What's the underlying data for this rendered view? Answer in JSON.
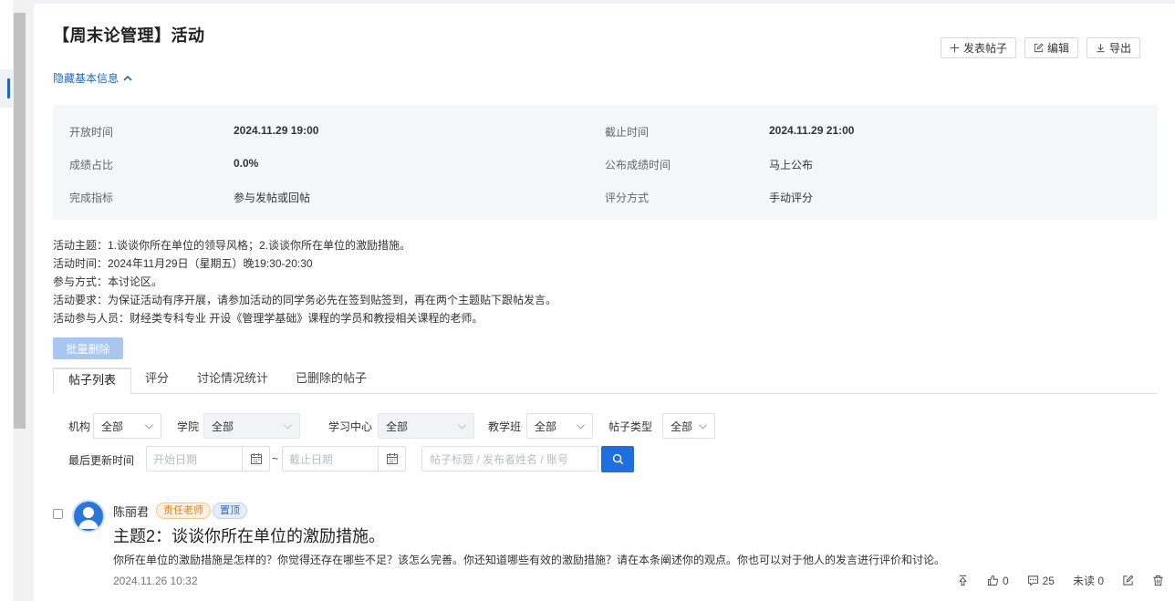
{
  "page": {
    "title": "【周末论管理】活动",
    "toggle_info": "隐藏基本信息"
  },
  "actions": {
    "post": "发表帖子",
    "edit": "编辑",
    "export": "导出"
  },
  "info": [
    {
      "label": "开放时间",
      "value": "2024.11.29 19:00"
    },
    {
      "label": "截止时间",
      "value": "2024.11.29 21:00"
    },
    {
      "label": "成绩占比",
      "value": "0.0%"
    },
    {
      "label": "公布成绩时间",
      "value": "马上公布"
    },
    {
      "label": "完成指标",
      "value": "参与发帖或回帖"
    },
    {
      "label": "评分方式",
      "value": "手动评分"
    }
  ],
  "description": [
    "活动主题：1.谈谈你所在单位的领导风格；2.谈谈你所在单位的激励措施。",
    "活动时间：2024年11月29日（星期五）晚19:30-20:30",
    "参与方式：本讨论区。",
    "活动要求：为保证活动有序开展，请参加活动的同学务必先在签到贴签到，再在两个主题贴下跟帖发言。",
    "活动参与人员：财经类专科专业 开设《管理学基础》课程的学员和教授相关课程的老师。"
  ],
  "batch_delete": "批量删除",
  "tabs": [
    {
      "label": "帖子列表",
      "active": true
    },
    {
      "label": "评分"
    },
    {
      "label": "讨论情况统计"
    },
    {
      "label": "已删除的帖子"
    }
  ],
  "filters": {
    "org_label": "机构",
    "org_value": "全部",
    "college_label": "学院",
    "college_value": "全部",
    "center_label": "学习中心",
    "center_value": "全部",
    "class_label": "教学班",
    "class_value": "全部",
    "type_label": "帖子类型",
    "type_value": "全部",
    "updated_label": "最后更新时间",
    "start_placeholder": "开始日期",
    "end_placeholder": "截止日期",
    "range_sep": "~",
    "search_placeholder": "帖子标题 / 发布者姓名 / 账号"
  },
  "post": {
    "author": "陈丽君",
    "badge_role": "责任老师",
    "badge_pin": "置顶",
    "title": "主题2：谈谈你所在单位的激励措施。",
    "body": "你所在单位的激励措施是怎样的？你觉得还存在哪些不足？该怎么完善。你还知道哪些有效的激励措施？请在本条阐述你的观点。你也可以对于他人的发言进行评价和讨论。",
    "date": "2024.11.26 10:32",
    "likes": "0",
    "comments": "25",
    "unread": "未读 0"
  },
  "colors": {
    "primary": "#1e6fe0",
    "link": "#1e64c8",
    "badge_teacher": "#e67e17"
  }
}
